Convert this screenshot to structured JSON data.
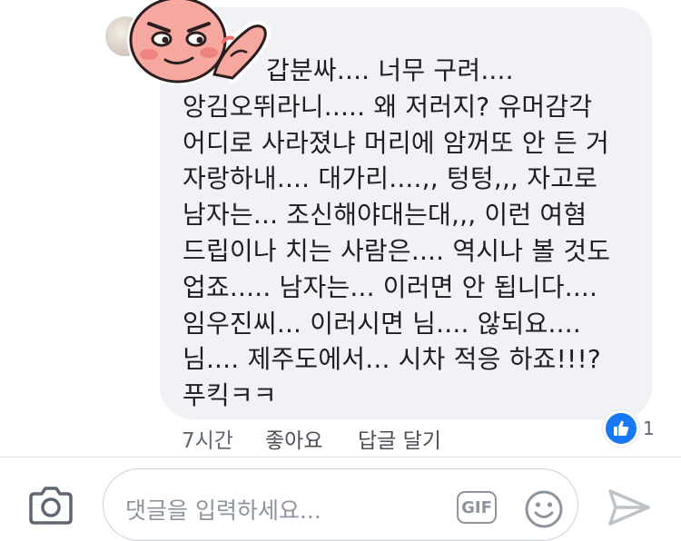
{
  "comment": {
    "lines": [
      "갑분싸.... 너무 구려....",
      "앙김오뛰라니..... 왜 저러지? 유머감각",
      "어디로 사라졌냐 머리에 암꺼또 안 든 거",
      "자랑하내.... 대가리....,, 텅텅,,, 자고로",
      "남자는... 조신해야대는대,,, 이런 여혐",
      "드립이나 치는 사람은.... 역시나 볼 것도",
      "업죠..... 남자는... 이러면 안 됩니다....",
      "임우진씨... 이러시면 님.... 않되요....",
      "님.... 제주도에서... 시차 적응 하죠!!!?",
      "푸킥ㅋㅋ"
    ]
  },
  "meta": {
    "time": "7시간",
    "like_label": "좋아요",
    "reply_label": "답글 달기"
  },
  "reaction": {
    "icon": "thumbs-up-icon",
    "count": "1",
    "color": "#1877f2"
  },
  "composer": {
    "placeholder": "댓글을 입력하세요...",
    "gif_label": "GIF"
  }
}
